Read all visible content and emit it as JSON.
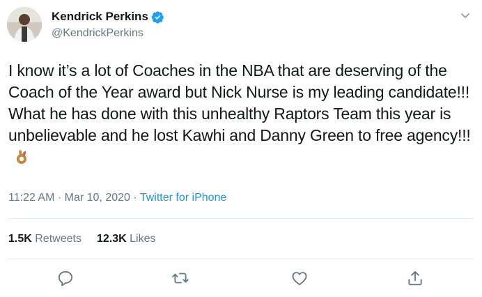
{
  "author": {
    "display_name": "Kendrick Perkins",
    "handle": "@KendrickPerkins",
    "verified": true
  },
  "tweet": {
    "text": "I know it’s a lot of Coaches in the NBA that are deserving of the Coach of the Year award but Nick Nurse is my leading candidate!!! What he has done with this unhealthy Raptors Team this year is unbelievable and he lost Kawhi and Danny Green to free agency!!!",
    "emoji": "ok-hand-emoji"
  },
  "meta": {
    "time": "11:22 AM",
    "separator1": " · ",
    "date": "Mar 10, 2020",
    "separator2": " · ",
    "source": "Twitter for iPhone"
  },
  "stats": {
    "retweets_count": "1.5K",
    "retweets_label": "Retweets",
    "likes_count": "12.3K",
    "likes_label": "Likes"
  },
  "colors": {
    "accent": "#1b95e0",
    "verified": "#1da1f2",
    "muted": "#657786",
    "text": "#14171a"
  },
  "icons": {
    "reply": "reply-icon",
    "retweet": "retweet-icon",
    "like": "heart-icon",
    "share": "share-icon",
    "more": "chevron-down-icon"
  }
}
